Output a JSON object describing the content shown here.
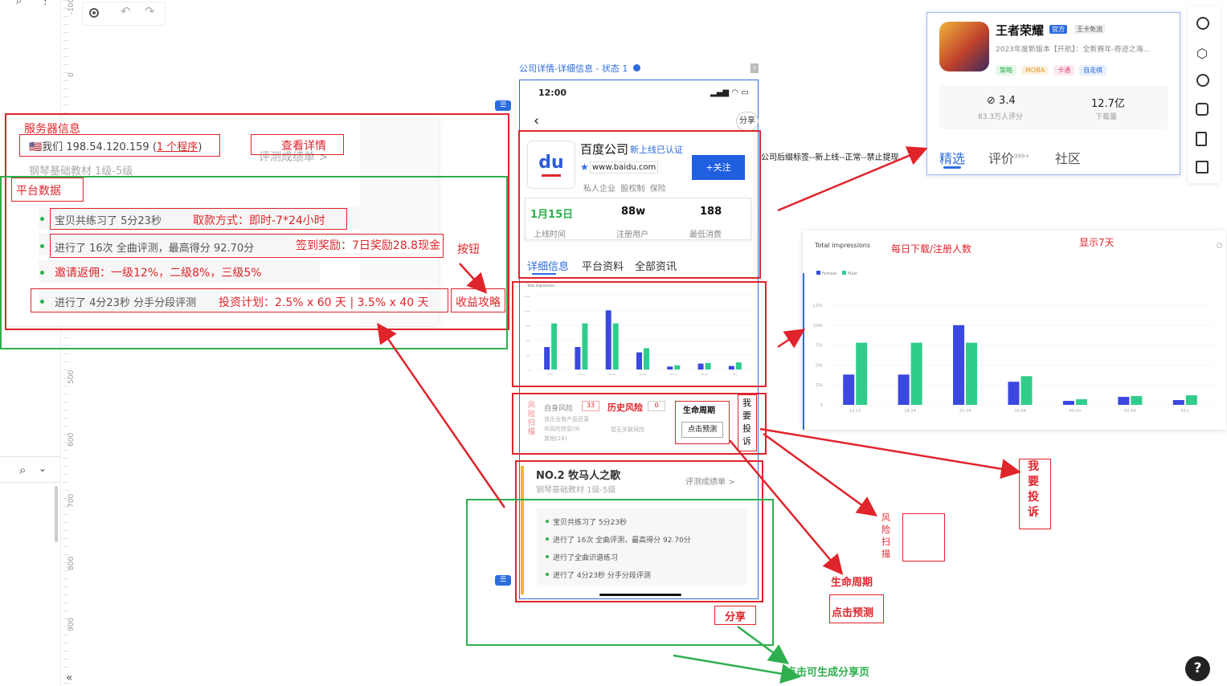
{
  "canvas": {
    "ruler_labels": [
      "-100",
      "0",
      "500",
      "600",
      "700",
      "800",
      "900"
    ]
  },
  "toolbar": {
    "target_icon": "target-icon",
    "undo_icon": "undo-icon",
    "redo_icon": "redo-icon"
  },
  "left_panel": {
    "server_info_label": "服务器信息",
    "server_line": "🇺🇸我们 198.54.120.159 (",
    "program_link": "1 个程序",
    "server_close": ")",
    "view_details": "查看详情",
    "bg_hint1": "钢琴基础教材 1级-5级",
    "bg_hint2": "评测成绩单 >",
    "platform_data_label": "平台数据",
    "bullets": [
      {
        "text": "宝贝共练习了 5分23秒",
        "overlay": "取款方式：即时-7*24小时"
      },
      {
        "text": "进行了 16次 全曲评测，最高得分 92.70分",
        "overlay": "签到奖励：7日奖励28.8现金"
      },
      {
        "text": "邀请返佣：一级12%，二级8%，三级5%",
        "overlay": ""
      },
      {
        "text": "进行了 4分23秒 分手分段评测",
        "overlay": "投资计划：2.5% x 60 天 | 3.5% x 40 天"
      }
    ],
    "button_label": "按钮",
    "strategy_label": "收益攻略"
  },
  "frame_title": "公司详情-详细信息 - 状态 1",
  "phone": {
    "time": "12:00",
    "share": "分享",
    "company_name": "百度公司",
    "new_tag": "新上线",
    "certified": "已认证",
    "website": "www.baidu.com",
    "tags": "私人企业  股权制  保险",
    "follow": "+关注",
    "stats": [
      {
        "value": "1月15日",
        "label": "上线时间"
      },
      {
        "value": "88w",
        "label": "注册用户"
      },
      {
        "value": "188",
        "label": "最低消费"
      }
    ],
    "tabs": [
      "详细信息",
      "平台资料",
      "全部资讯"
    ],
    "mini_chart_title": "Total impressions",
    "risk": {
      "risk_scan": "风险扫描",
      "self_risk": "自身风险",
      "self_risk_count": "33",
      "history_risk": "历史风险",
      "history_risk_count": "0",
      "lifecycle": "生命周期",
      "predict": "点击预测",
      "complaint": "我要投诉",
      "risk_lines": [
        "该企业有产品目录",
        "中风险信息(9)",
        "其他(24)"
      ],
      "history_line": "暂无关联风险"
    },
    "course": {
      "title": "NO.2 牧马人之歌",
      "subtitle": "钢琴基础教材 1级-5级",
      "report": "评测成绩单 >",
      "items": [
        "宝贝共练习了 5分23秒",
        "进行了 16次 全曲评测，最高得分 92.70分",
        "进行了全曲识谱练习",
        "进行了 4分23秒 分手分段评测"
      ]
    }
  },
  "annotations": {
    "tag_note": "公司后缀标签--新上线--正常--禁止提现",
    "daily_note": "每日下载/注册人数",
    "show7": "显示7天",
    "complaint_big": "我要投诉",
    "risk_scan_big": "风险扫描",
    "lifecycle_big": "生命周期",
    "predict_big": "点击预测",
    "share_big": "分享",
    "share_note": "点击可生成分享页"
  },
  "app_card": {
    "name": "王者荣耀",
    "official": "官方",
    "free": "王卡免流",
    "desc": "2023年度新版本【开航】：全新赛年-奇迹之海...",
    "tags": [
      "策略",
      "MOBA",
      "卡通",
      "自走棋"
    ],
    "rating": "3.4",
    "rating_sub": "83.3万人评分",
    "downloads": "12.7亿",
    "downloads_sub": "下载量",
    "tabs": [
      "精选",
      "评价",
      "社区"
    ],
    "review_count": "999+"
  },
  "chart_data": {
    "type": "bar",
    "title": "Total impressions",
    "series": [
      {
        "name": "Female",
        "color": "#3b48e0",
        "values": [
          38000,
          38000,
          100000,
          29000,
          5000,
          10000,
          6000
        ]
      },
      {
        "name": "Male",
        "color": "#2fcc8b",
        "values": [
          78000,
          78000,
          78000,
          36000,
          7000,
          11000,
          12000
        ]
      }
    ],
    "categories": [
      "13-17",
      "18-24",
      "25-34",
      "35-44",
      "45-54",
      "55-64",
      "65+"
    ],
    "y_ticks": [
      "0",
      "25k",
      "50k",
      "75k",
      "100k",
      "125k"
    ],
    "ylim": [
      0,
      125000
    ]
  },
  "help": "?"
}
